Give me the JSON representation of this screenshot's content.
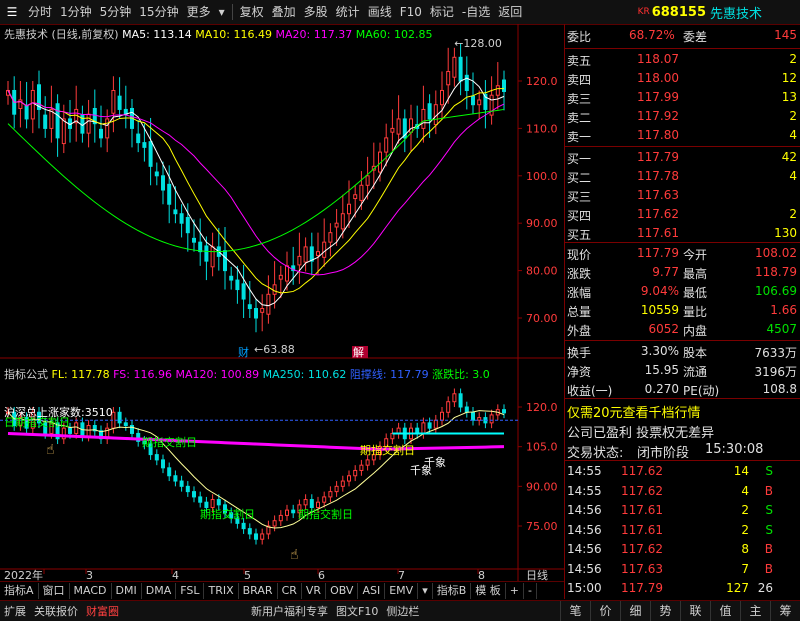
{
  "toolbar": {
    "left": [
      "分时",
      "1分钟",
      "5分钟",
      "15分钟",
      "更多"
    ],
    "mid": [
      "复权",
      "叠加",
      "多股",
      "统计",
      "画线",
      "F10",
      "标记",
      "-自选",
      "返回"
    ],
    "kr": "KR",
    "code": "688155",
    "name": "先惠技术"
  },
  "main_legend": {
    "title": "先惠技术 (日线,前复权)",
    "ma5": "MA5: 113.14",
    "ma10": "MA10: 116.49",
    "ma20": "MA20: 117.37",
    "ma60": "MA60: 102.85"
  },
  "main_chart": {
    "y_ticks": [
      "120.0",
      "110.0",
      "100.0",
      "90.00",
      "80.00",
      "70.00"
    ],
    "high_label": "128.00",
    "low_label": "63.88",
    "markers": [
      "财",
      "解"
    ]
  },
  "sub_legend": {
    "title": "指标公式",
    "fl": "FL: 117.78",
    "fs": "FS: 116.96",
    "ma120": "MA120: 100.89",
    "ma250": "MA250: 110.62",
    "zhichi": "阻撑线: 117.79",
    "zdb": "涨跌比: 3.0"
  },
  "sub_chart": {
    "y_ticks": [
      "120.0",
      "105.0",
      "90.00",
      "75.00"
    ],
    "notes": [
      "沪深总上涨家数:3510",
      "日期指交割日",
      "期指交割日",
      "期指交割日",
      "期指交割日",
      "期指交割日",
      "千象",
      "千象"
    ]
  },
  "x_axis": {
    "labels": [
      "2022年",
      "3",
      "4",
      "5",
      "6",
      "7",
      "8"
    ],
    "right": "日线"
  },
  "bottom_tabs": [
    "指标A",
    "窗口",
    "MACD",
    "DMI",
    "DMA",
    "FSL",
    "TRIX",
    "BRAR",
    "CR",
    "VR",
    "OBV",
    "ASI",
    "EMV",
    "指标B",
    "模 板",
    "+",
    "-"
  ],
  "quote": {
    "weibi_label": "委比",
    "weibi": "68.72%",
    "weicha_label": "委差",
    "weicha": "145",
    "asks": [
      {
        "label": "卖五",
        "price": "118.07",
        "vol": "2"
      },
      {
        "label": "卖四",
        "price": "118.00",
        "vol": "12"
      },
      {
        "label": "卖三",
        "price": "117.99",
        "vol": "13"
      },
      {
        "label": "卖二",
        "price": "117.92",
        "vol": "2"
      },
      {
        "label": "卖一",
        "price": "117.80",
        "vol": "4"
      }
    ],
    "bids": [
      {
        "label": "买一",
        "price": "117.79",
        "vol": "42"
      },
      {
        "label": "买二",
        "price": "117.78",
        "vol": "4"
      },
      {
        "label": "买三",
        "price": "117.63",
        "vol": ""
      },
      {
        "label": "买四",
        "price": "117.62",
        "vol": "2"
      },
      {
        "label": "买五",
        "price": "117.61",
        "vol": "130"
      }
    ],
    "stats": [
      {
        "l1": "现价",
        "v1": "117.79",
        "l2": "今开",
        "v2": "108.02"
      },
      {
        "l1": "涨跌",
        "v1": "9.77",
        "l2": "最高",
        "v2": "118.79"
      },
      {
        "l1": "涨幅",
        "v1": "9.04%",
        "l2": "最低",
        "v2": "106.69"
      },
      {
        "l1": "总量",
        "v1": "10559",
        "l2": "量比",
        "v2": "1.66"
      },
      {
        "l1": "外盘",
        "v1": "6052",
        "l2": "内盘",
        "v2": "4507"
      }
    ],
    "stats2": [
      {
        "l1": "换手",
        "v1": "3.30%",
        "l2": "股本",
        "v2": "7633万"
      },
      {
        "l1": "净资",
        "v1": "15.95",
        "l2": "流通",
        "v2": "3196万"
      },
      {
        "l1": "收益(一)",
        "v1": "0.270",
        "l2": "PE(动)",
        "v2": "108.8"
      }
    ],
    "promo1": "仅需20元查看千档行情",
    "promo2": "公司已盈利 投票权无差异",
    "status_label": "交易状态:",
    "status_val": "闭市阶段",
    "status_time": "15:30:08",
    "ticks": [
      {
        "t": "14:55",
        "p": "117.62",
        "v": "14",
        "d": "S"
      },
      {
        "t": "14:55",
        "p": "117.62",
        "v": "4",
        "d": "B"
      },
      {
        "t": "14:56",
        "p": "117.61",
        "v": "2",
        "d": "S"
      },
      {
        "t": "14:56",
        "p": "117.61",
        "v": "2",
        "d": "S"
      },
      {
        "t": "14:56",
        "p": "117.62",
        "v": "8",
        "d": "B"
      },
      {
        "t": "14:56",
        "p": "117.63",
        "v": "7",
        "d": "B"
      },
      {
        "t": "15:00",
        "p": "117.79",
        "v": "127",
        "d": "26"
      }
    ]
  },
  "status_bar": [
    "扩展",
    "关联报价",
    "财富圈",
    "新用户福利专享",
    "图文F10",
    "侧边栏"
  ],
  "right_tabs": [
    "笔",
    "价",
    "细",
    "势",
    "联",
    "值",
    "主",
    "筹"
  ],
  "colors": {
    "up": "#ff3b3b",
    "down": "#00e0e0",
    "ma5": "#ffffff",
    "ma10": "#ffff00",
    "ma20": "#ff00ff",
    "ma60": "#00ff00"
  }
}
